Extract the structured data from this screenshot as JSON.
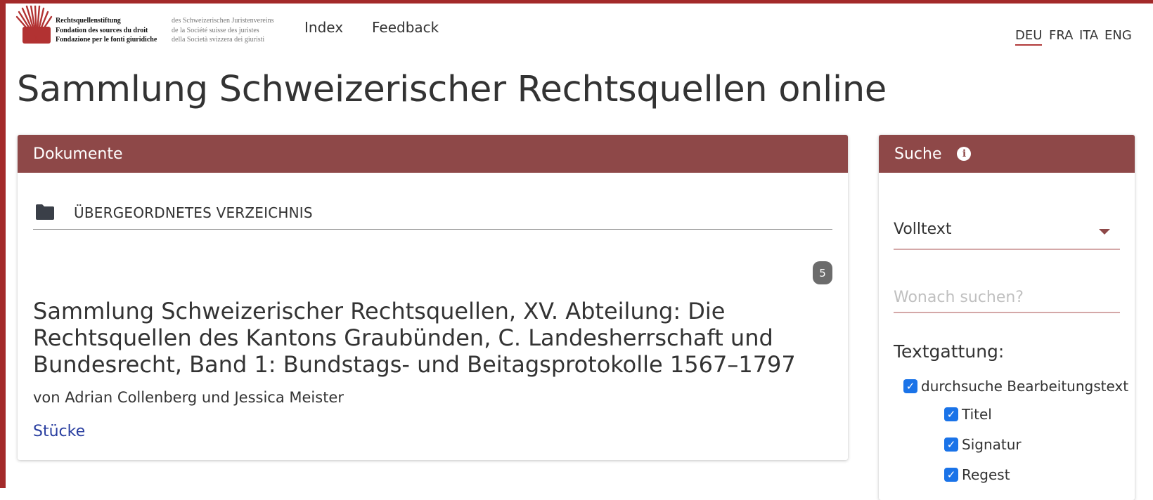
{
  "brand": {
    "org_names": [
      "Rechtsquellenstiftung",
      "Fondation des sources du droit",
      "Fondazione per le fonti giuridiche"
    ],
    "org_subtitles": [
      "des Schweizerischen Juristenvereins",
      "de la Société suisse des juristes",
      "della Società svizzera dei giuristi"
    ],
    "accent_color": "#8e4848",
    "frame_color": "#a32a2a"
  },
  "nav": {
    "index_label": "Index",
    "feedback_label": "Feedback"
  },
  "languages": [
    {
      "code": "DEU",
      "active": true
    },
    {
      "code": "FRA",
      "active": false
    },
    {
      "code": "ITA",
      "active": false
    },
    {
      "code": "ENG",
      "active": false
    }
  ],
  "page_title": "Sammlung Schweizerischer Rechtsquellen online",
  "documents": {
    "header": "Dokumente",
    "parent_dir_label": "ÜBERGEORDNETES VERZEICHNIS",
    "parent_dir_icon": "folder-icon",
    "count_badge": "5",
    "doc_title": "Sammlung Schweizerischer Rechtsquellen, XV. Abteilung: Die Rechtsquellen des Kantons Graubünden, C. Landesherrschaft und Bundesrecht, Band 1: Bundstags- und Beitagsprotokolle 1567–1797",
    "doc_authors": "von Adrian Collenberg und Jessica Meister",
    "doc_link": "Stücke"
  },
  "search": {
    "header": "Suche",
    "info_icon": "info-icon",
    "mode_selected": "Volltext",
    "placeholder": "Wonach suchen?",
    "genre_label": "Textgattung:",
    "options": [
      {
        "label": "durchsuche Bearbeitungstext",
        "checked": true
      },
      {
        "label": "Titel",
        "checked": true
      },
      {
        "label": "Signatur",
        "checked": true
      },
      {
        "label": "Regest",
        "checked": true
      }
    ]
  }
}
